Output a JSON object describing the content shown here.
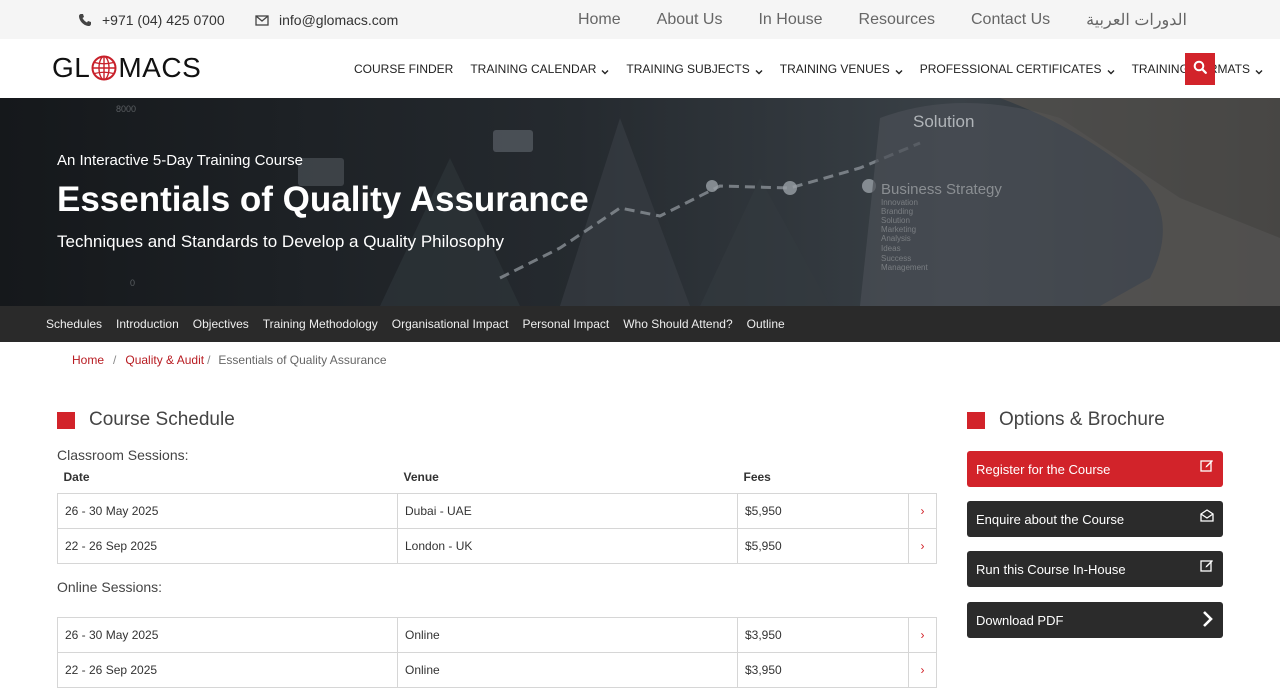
{
  "topbar": {
    "phone": "+971 (04) 425 0700",
    "email": "info@glomacs.com",
    "links": [
      "Home",
      "About Us",
      "In House",
      "Resources",
      "Contact Us",
      "الدورات العربية"
    ]
  },
  "header": {
    "logo_left": "GL",
    "logo_right": "MACS",
    "nav": [
      {
        "label": "COURSE FINDER",
        "dropdown": false
      },
      {
        "label": "TRAINING CALENDAR",
        "dropdown": true
      },
      {
        "label": "TRAINING SUBJECTS",
        "dropdown": true
      },
      {
        "label": "TRAINING VENUES",
        "dropdown": true
      },
      {
        "label": "PROFESSIONAL CERTIFICATES",
        "dropdown": true
      },
      {
        "label": "TRAINING FORMATS",
        "dropdown": true
      }
    ]
  },
  "hero": {
    "kicker": "An Interactive 5-Day Training Course",
    "title": "Essentials of Quality Assurance",
    "subtitle": "Techniques and Standards to Develop a Quality Philosophy",
    "bg_words": [
      "Solution",
      "Business Strategy",
      "Innovation",
      "Branding",
      "Solution",
      "Marketing",
      "Analysis",
      "Ideas",
      "Success",
      "Management"
    ],
    "bg_axis": [
      "8000",
      "0"
    ]
  },
  "subnav": [
    "Schedules",
    "Introduction",
    "Objectives",
    "Training Methodology",
    "Organisational Impact",
    "Personal Impact",
    "Who Should Attend?",
    "Outline"
  ],
  "breadcrumb": {
    "home": "Home",
    "sep": "/",
    "category": "Quality & Audit",
    "current": "Essentials of Quality Assurance"
  },
  "schedule": {
    "heading": "Course Schedule",
    "classroom_label": "Classroom Sessions:",
    "headers": {
      "date": "Date",
      "venue": "Venue",
      "fees": "Fees"
    },
    "classroom": [
      {
        "date": "26 - 30 May 2025",
        "venue": "Dubai - UAE",
        "fees": "$5,950"
      },
      {
        "date": "22 - 26 Sep 2025",
        "venue": "London - UK",
        "fees": "$5,950"
      }
    ],
    "online_label": "Online Sessions:",
    "online": [
      {
        "date": "26 - 30 May 2025",
        "venue": "Online",
        "fees": "$3,950"
      },
      {
        "date": "22 - 26 Sep 2025",
        "venue": "Online",
        "fees": "$3,950"
      }
    ],
    "arrow": "›"
  },
  "options": {
    "heading": "Options & Brochure",
    "buttons": [
      {
        "label": "Register for the Course",
        "icon": "edit-icon"
      },
      {
        "label": "Enquire about the Course",
        "icon": "envelope-open-icon"
      },
      {
        "label": "Run this Course In-House",
        "icon": "edit-icon"
      },
      {
        "label": "Download PDF",
        "icon": "chevron-right-icon"
      }
    ]
  },
  "colors": {
    "brand_red": "#d2232a",
    "dark": "#2b2b2b"
  }
}
